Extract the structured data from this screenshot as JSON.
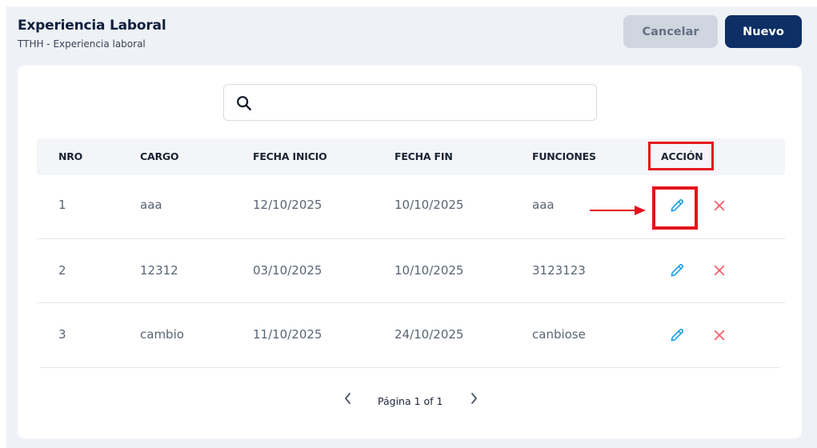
{
  "header": {
    "title": "Experiencia Laboral",
    "breadcrumb": "TTHH  - Experiencia laboral",
    "cancel_label": "Cancelar",
    "new_label": "Nuevo"
  },
  "search": {
    "value": "",
    "placeholder": ""
  },
  "table": {
    "columns": [
      "NRO",
      "CARGO",
      "FECHA INICIO",
      "FECHA FIN",
      "FUNCIONES",
      "ACCIÓN"
    ],
    "rows": [
      {
        "nro": "1",
        "cargo": "aaa",
        "fecha_inicio": "12/10/2025",
        "fecha_fin": "10/10/2025",
        "funciones": "aaa"
      },
      {
        "nro": "2",
        "cargo": "12312",
        "fecha_inicio": "03/10/2025",
        "fecha_fin": "10/10/2025",
        "funciones": "3123123"
      },
      {
        "nro": "3",
        "cargo": "cambio",
        "fecha_inicio": "11/10/2025",
        "fecha_fin": "24/10/2025",
        "funciones": "canbiose"
      }
    ]
  },
  "pagination": {
    "label": "Página 1 of 1"
  },
  "icons": {
    "search": "search-icon",
    "edit": "pencil-icon",
    "delete": "close-icon",
    "prev": "chevron-left-icon",
    "next": "chevron-right-icon"
  },
  "colors": {
    "primary": "#0d2f66",
    "cancel_bg": "#cfd6df",
    "edit": "#1ea0e6",
    "delete": "#f0616b",
    "annotation": "#e3141c"
  }
}
